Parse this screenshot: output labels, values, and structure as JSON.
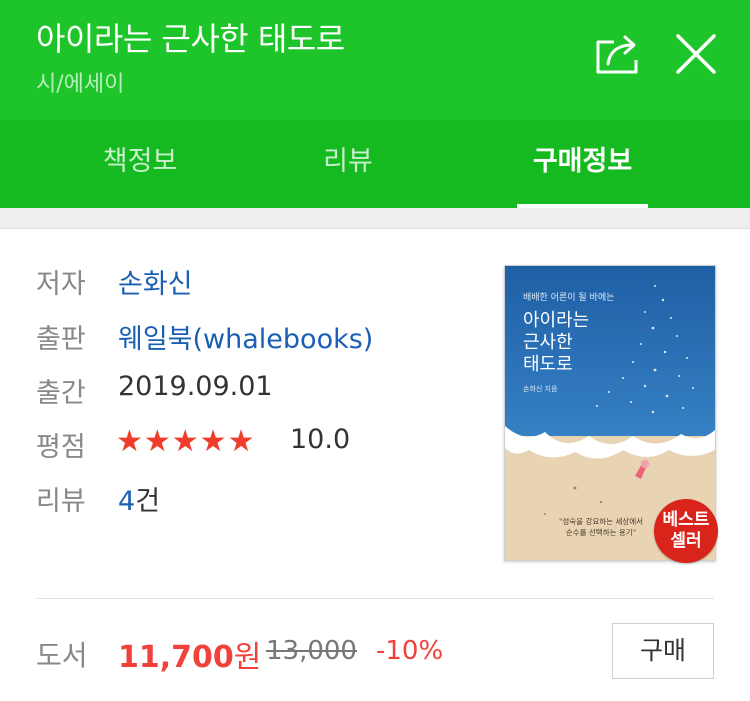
{
  "header": {
    "title": "아이라는 근사한 태도로",
    "subtitle": "시/에세이"
  },
  "tabs": [
    {
      "label": "책정보",
      "active": false
    },
    {
      "label": "리뷰",
      "active": false
    },
    {
      "label": "구매정보",
      "active": true
    }
  ],
  "info": {
    "author_label": "저자",
    "author": "손화신",
    "publisher_label": "출판",
    "publisher": "웨일북(whalebooks)",
    "date_label": "출간",
    "date": "2019.09.01",
    "rating_label": "평점",
    "stars": "★★★★★",
    "rating": "10.0",
    "review_label": "리뷰",
    "review_count": "4",
    "review_unit": "건"
  },
  "cover": {
    "tagline": "배배한 어른이 될 바에는",
    "title_lines": [
      "아이라는",
      "근사한",
      "태도로"
    ],
    "author_small": "손화신 지음",
    "quote_lines": [
      "\"성숙을 강요하는 세상에서",
      "순수를 선택하는 용기\""
    ]
  },
  "badge": {
    "line1": "베스트",
    "line2": "셀러"
  },
  "price": {
    "label": "도서",
    "sale": "11,700",
    "sale_unit": "원",
    "original": "13,000",
    "discount": "-10%",
    "buy_label": "구매"
  },
  "colors": {
    "header": "#1ec52a",
    "tabs": "#15b920",
    "sale": "#f0413a",
    "link": "#1a5fb4",
    "stars": "#f03c2a",
    "badge": "#d9241b"
  },
  "icons": {
    "share": "share-icon",
    "close": "close-icon"
  }
}
